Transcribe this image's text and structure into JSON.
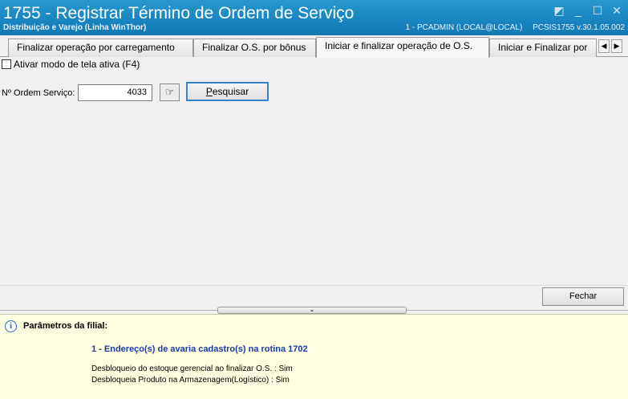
{
  "window": {
    "title": "1755 - Registrar Término de Ordem de Serviço",
    "subtitle": "Distribuição e Varejo (Linha WinThor)",
    "user": "1 - PCADMIN (LOCAL@LOCAL)",
    "version": "PCSIS1755  v.30.1.05.002"
  },
  "tabs": [
    {
      "label": "Finalizar operação por carregamento"
    },
    {
      "label": "Finalizar O.S. por bônus"
    },
    {
      "label": "Iniciar e finalizar operação de O.S."
    },
    {
      "label": "Iniciar e Finalizar por"
    }
  ],
  "active_tab": 2,
  "checkbox": {
    "label": "Ativar modo de tela ativa (F4)",
    "checked": false
  },
  "search": {
    "label": "Nº Ordem Serviço:",
    "value": "4033",
    "button_prefix": "P",
    "button_rest": "esquisar"
  },
  "close_button": "Fechar",
  "params": {
    "title": "Parâmetros da filial:",
    "item": "1 - Endereço(s) de avaria cadastro(s) na rotina 1702",
    "line1": "Desbloqueio do estoque gerencial ao finalizar O.S. : Sim",
    "line2": "Desbloqueia Produto na Armazenagem(Logístico) : Sim"
  }
}
